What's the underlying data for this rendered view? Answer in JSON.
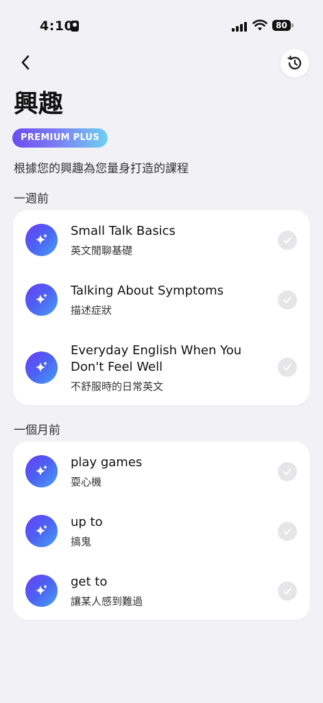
{
  "status": {
    "time": "4:10",
    "battery": "80"
  },
  "header": {
    "title": "興趣",
    "badge": "PREMIUM PLUS",
    "subtitle": "根據您的興趣為您量身打造的課程"
  },
  "sections": [
    {
      "label": "一週前",
      "items": [
        {
          "title": "Small Talk Basics",
          "subtitle": "英文閒聊基礎"
        },
        {
          "title": "Talking About Symptoms",
          "subtitle": "描述症狀"
        },
        {
          "title": "Everyday English When You Don't Feel Well",
          "subtitle": "不舒服時的日常英文"
        }
      ]
    },
    {
      "label": "一個月前",
      "items": [
        {
          "title": "play games",
          "subtitle": "耍心機"
        },
        {
          "title": "up to",
          "subtitle": "搞鬼"
        },
        {
          "title": "get to",
          "subtitle": "讓某人感到難過"
        }
      ]
    }
  ]
}
